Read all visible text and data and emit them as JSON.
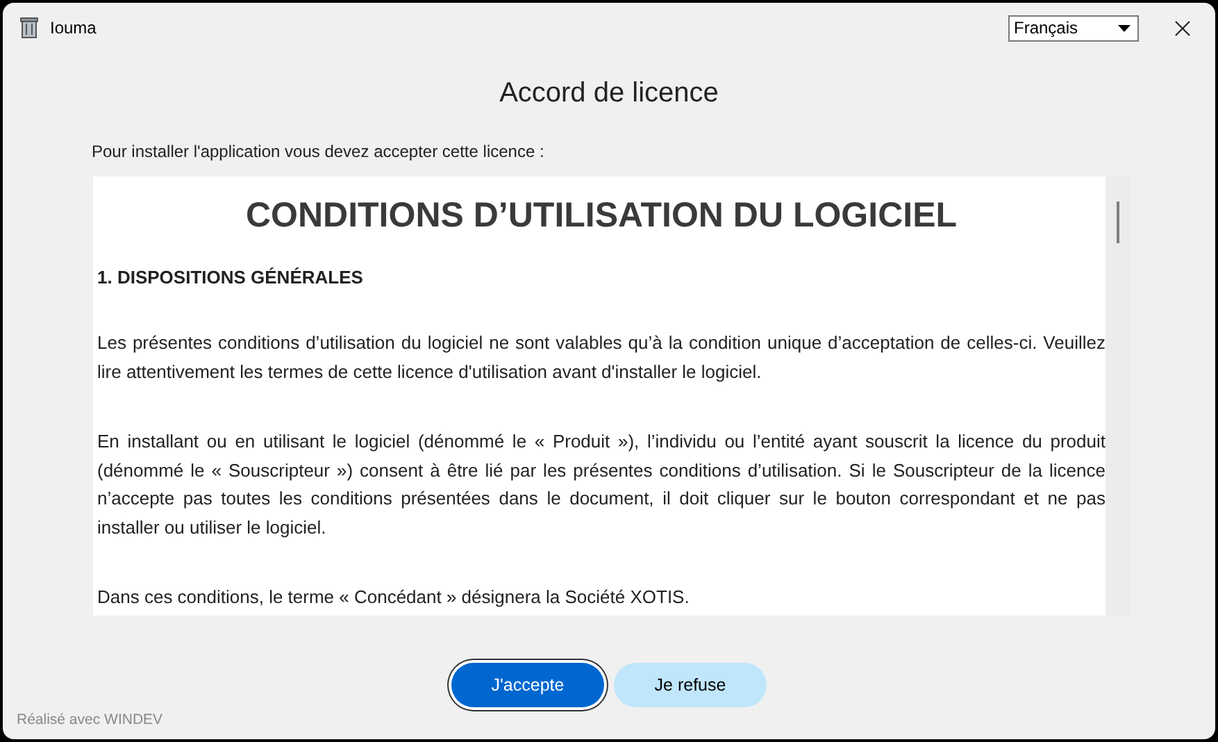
{
  "window": {
    "title": "Iouma"
  },
  "language": {
    "value": "Français"
  },
  "heading": "Accord de licence",
  "intro": "Pour installer l'application vous devez accepter cette licence :",
  "license": {
    "title": "CONDITIONS D’UTILISATION DU LOGICIEL",
    "blocks": [
      {
        "kind": "section",
        "text": "1. DISPOSITIONS GÉNÉRALES"
      },
      {
        "kind": "paragraph",
        "text": "Les présentes conditions d’utilisation du logiciel ne sont valables qu’à la condition unique d’acceptation de celles-ci. Veuillez lire attentivement les termes de cette licence d'utilisation avant d'installer le logiciel."
      },
      {
        "kind": "paragraph",
        "text": "En installant ou en utilisant le logiciel (dénommé le « Produit »), l’individu ou l’entité ayant souscrit la licence du produit (dénommé le « Souscripteur ») consent à être lié par les présentes conditions d’utilisation. Si le Souscripteur de la licence n’accepte pas toutes les conditions présentées dans le document, il doit cliquer sur le bouton correspondant et ne pas installer ou utiliser le logiciel."
      },
      {
        "kind": "paragraph",
        "text": "Dans ces conditions, le terme « Concédant » désignera la Société XOTIS."
      }
    ]
  },
  "buttons": [
    {
      "label": "J'accepte",
      "kind": "primary"
    },
    {
      "label": "Je refuse",
      "kind": "secondary"
    }
  ],
  "footer": "Réalisé avec WINDEV"
}
